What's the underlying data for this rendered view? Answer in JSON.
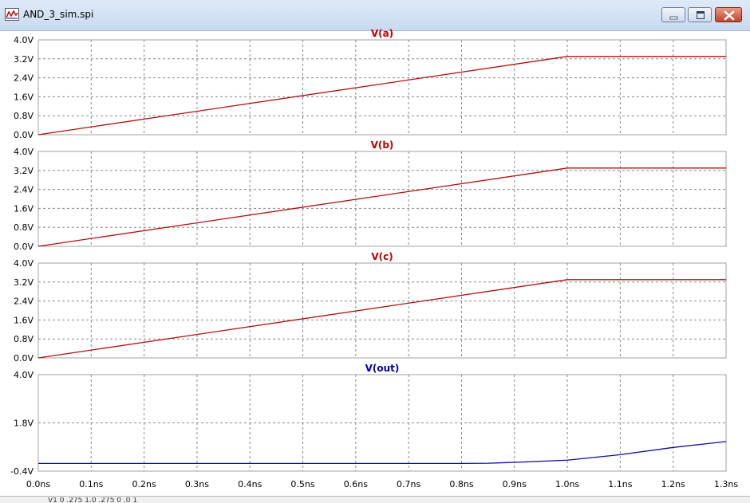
{
  "window": {
    "title": "AND_3_sim.spi",
    "status": "V1  0  .275  1.0  .275  0  .0  1"
  },
  "colors": {
    "trace_inputs": "#b01010",
    "trace_output": "#0a0aa8",
    "title_inputs": "#c00000",
    "title_output": "#0000b0",
    "grid": "#888888",
    "frame": "#a0a0a0"
  },
  "icons": {
    "app": "waveform-icon",
    "minimize": "minimize-icon",
    "maximize": "maximize-icon",
    "close": "close-icon"
  },
  "chart_data": [
    {
      "type": "line",
      "title": "V(a)",
      "x": [
        0.0,
        1.0,
        1.3
      ],
      "y": [
        0.0,
        3.3,
        3.3
      ],
      "ylim": [
        0.0,
        4.0
      ],
      "xlim": [
        0.0,
        1.3
      ],
      "yticks": [
        "0.0V",
        "0.8V",
        "1.6V",
        "2.4V",
        "3.2V",
        "4.0V"
      ],
      "grid": true
    },
    {
      "type": "line",
      "title": "V(b)",
      "x": [
        0.0,
        1.0,
        1.3
      ],
      "y": [
        0.0,
        3.3,
        3.3
      ],
      "ylim": [
        0.0,
        4.0
      ],
      "xlim": [
        0.0,
        1.3
      ],
      "yticks": [
        "0.0V",
        "0.8V",
        "1.6V",
        "2.4V",
        "3.2V",
        "4.0V"
      ],
      "grid": true
    },
    {
      "type": "line",
      "title": "V(c)",
      "x": [
        0.0,
        1.0,
        1.3
      ],
      "y": [
        0.0,
        3.3,
        3.3
      ],
      "ylim": [
        0.0,
        4.0
      ],
      "xlim": [
        0.0,
        1.3
      ],
      "yticks": [
        "0.0V",
        "0.8V",
        "1.6V",
        "2.4V",
        "3.2V",
        "4.0V"
      ],
      "grid": true
    },
    {
      "type": "line",
      "title": "V(out)",
      "x": [
        0.0,
        0.8,
        0.85,
        0.9,
        0.95,
        1.0,
        1.1,
        1.2,
        1.3
      ],
      "y": [
        -0.05,
        -0.05,
        -0.04,
        0.0,
        0.05,
        0.1,
        0.35,
        0.68,
        0.95
      ],
      "ylim": [
        -0.4,
        4.0
      ],
      "xlim": [
        0.0,
        1.3
      ],
      "yticks": [
        "-0.4V",
        "1.8V",
        "4.0V"
      ],
      "grid": true
    }
  ],
  "x_axis": {
    "ticks": [
      "0.0ns",
      "0.1ns",
      "0.2ns",
      "0.3ns",
      "0.4ns",
      "0.5ns",
      "0.6ns",
      "0.7ns",
      "0.8ns",
      "0.9ns",
      "1.0ns",
      "1.1ns",
      "1.2ns",
      "1.3ns"
    ]
  }
}
